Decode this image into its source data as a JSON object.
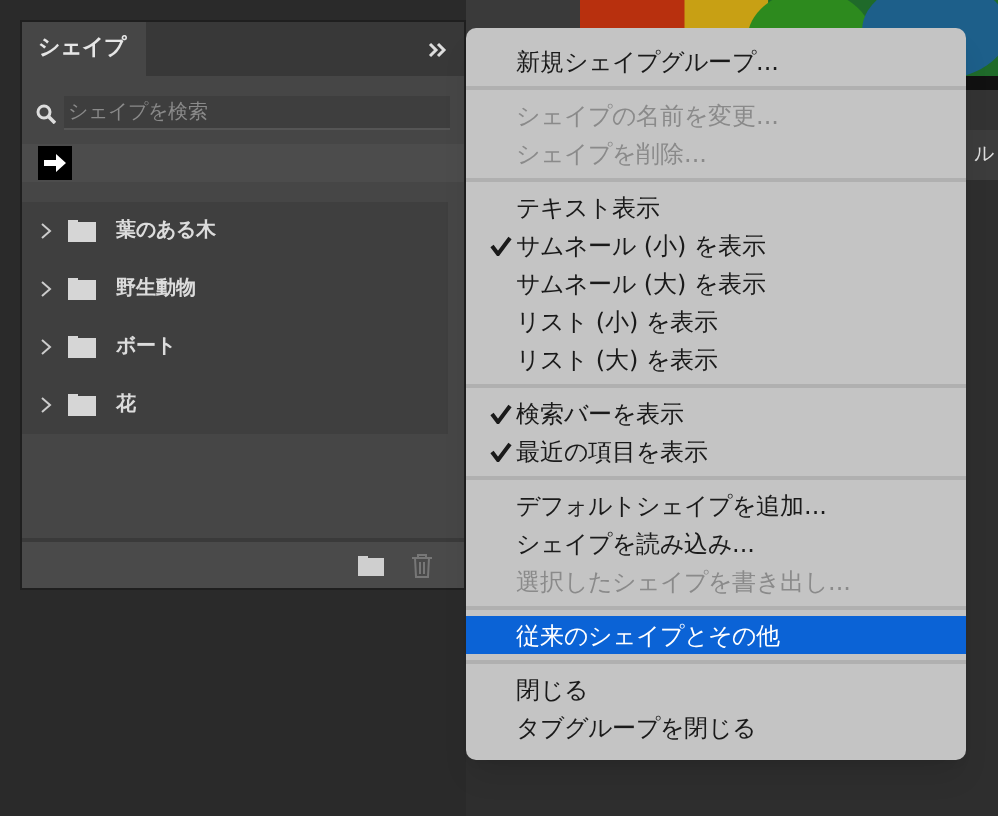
{
  "panel": {
    "tab": "シェイプ",
    "search": {
      "placeholder": "シェイプを検索"
    },
    "groups": [
      {
        "label": "葉のある木",
        "expanded": false
      },
      {
        "label": "野生動物",
        "expanded": false
      },
      {
        "label": "ボート",
        "expanded": false
      },
      {
        "label": "花",
        "expanded": false
      }
    ]
  },
  "background": {
    "cut_label": "ル"
  },
  "menu": {
    "groups": [
      [
        {
          "label": "新規シェイプグループ...",
          "checked": false,
          "disabled": false,
          "selected": false
        }
      ],
      [
        {
          "label": "シェイプの名前を変更...",
          "checked": false,
          "disabled": true,
          "selected": false
        },
        {
          "label": "シェイプを削除...",
          "checked": false,
          "disabled": true,
          "selected": false
        }
      ],
      [
        {
          "label": "テキスト表示",
          "checked": false,
          "disabled": false,
          "selected": false
        },
        {
          "label": "サムネール (小) を表示",
          "checked": true,
          "disabled": false,
          "selected": false
        },
        {
          "label": "サムネール (大) を表示",
          "checked": false,
          "disabled": false,
          "selected": false
        },
        {
          "label": "リスト (小) を表示",
          "checked": false,
          "disabled": false,
          "selected": false
        },
        {
          "label": "リスト (大) を表示",
          "checked": false,
          "disabled": false,
          "selected": false
        }
      ],
      [
        {
          "label": "検索バーを表示",
          "checked": true,
          "disabled": false,
          "selected": false
        },
        {
          "label": "最近の項目を表示",
          "checked": true,
          "disabled": false,
          "selected": false
        }
      ],
      [
        {
          "label": "デフォルトシェイプを追加...",
          "checked": false,
          "disabled": false,
          "selected": false
        },
        {
          "label": "シェイプを読み込み...",
          "checked": false,
          "disabled": false,
          "selected": false
        },
        {
          "label": "選択したシェイプを書き出し...",
          "checked": false,
          "disabled": true,
          "selected": false
        }
      ],
      [
        {
          "label": "従来のシェイプとその他",
          "checked": false,
          "disabled": false,
          "selected": true
        }
      ],
      [
        {
          "label": "閉じる",
          "checked": false,
          "disabled": false,
          "selected": false
        },
        {
          "label": "タブグループを閉じる",
          "checked": false,
          "disabled": false,
          "selected": false
        }
      ]
    ]
  }
}
